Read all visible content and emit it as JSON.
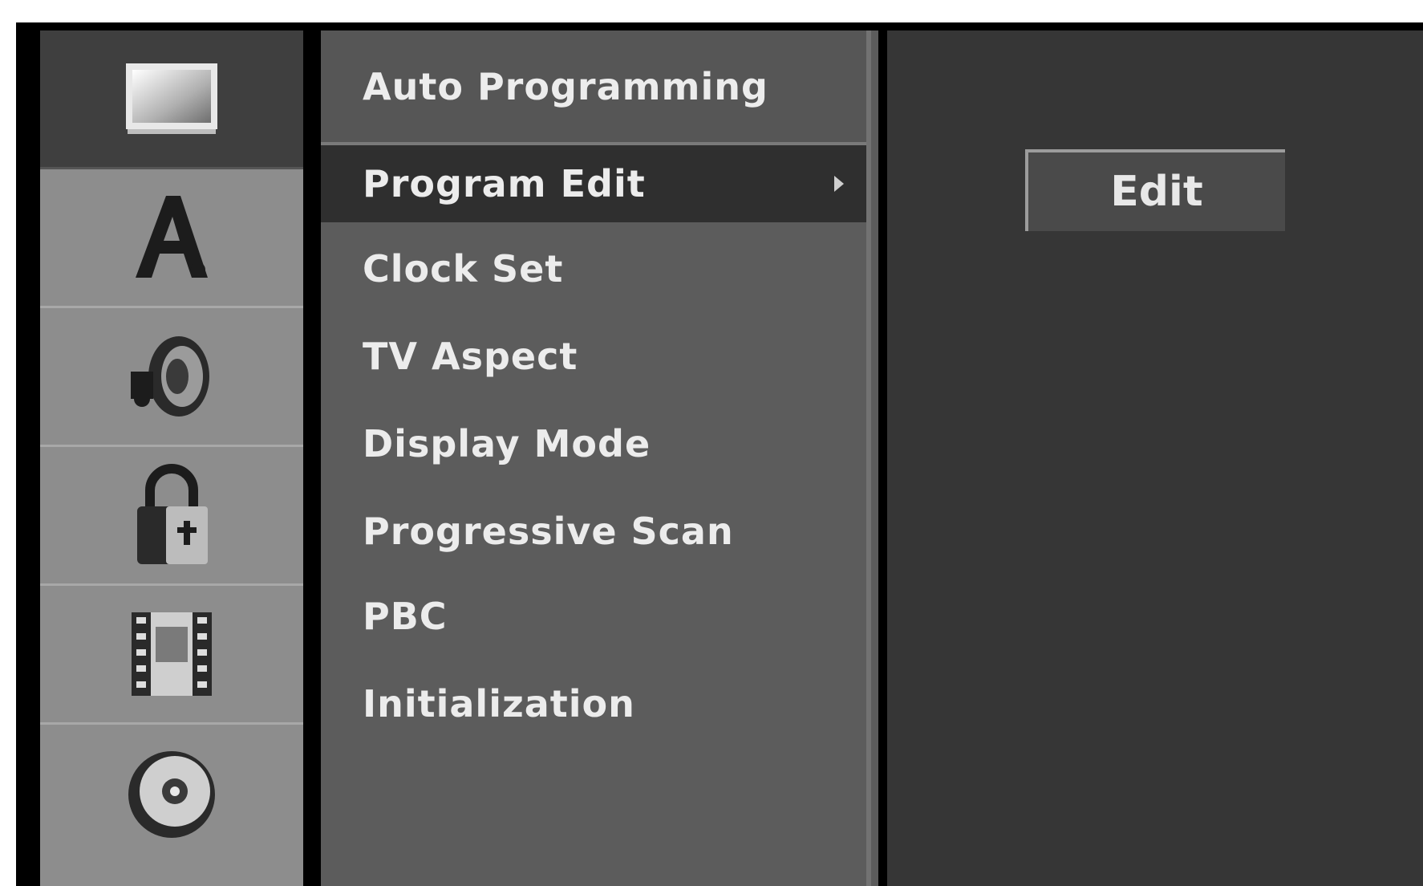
{
  "side_icons": [
    {
      "name": "tv-icon",
      "active": true
    },
    {
      "name": "language-icon"
    },
    {
      "name": "audio-icon"
    },
    {
      "name": "lock-icon"
    },
    {
      "name": "recording-icon"
    },
    {
      "name": "disc-icon"
    }
  ],
  "menu": {
    "items": [
      {
        "label": "Auto Programming"
      },
      {
        "label": "Program Edit",
        "selected": true
      },
      {
        "label": "Clock Set"
      },
      {
        "label": "TV Aspect"
      },
      {
        "label": "Display Mode"
      },
      {
        "label": "Progressive Scan"
      },
      {
        "label": "PBC"
      },
      {
        "label": "Initialization"
      }
    ]
  },
  "right_panel": {
    "edit_label": "Edit"
  },
  "colors": {
    "background": "#000000",
    "icon_column": "#8d8d8d",
    "menu_panel": "#5c5c5c",
    "selected_row": "#2f2f2f",
    "right_panel": "#363636",
    "text": "#ececec"
  }
}
